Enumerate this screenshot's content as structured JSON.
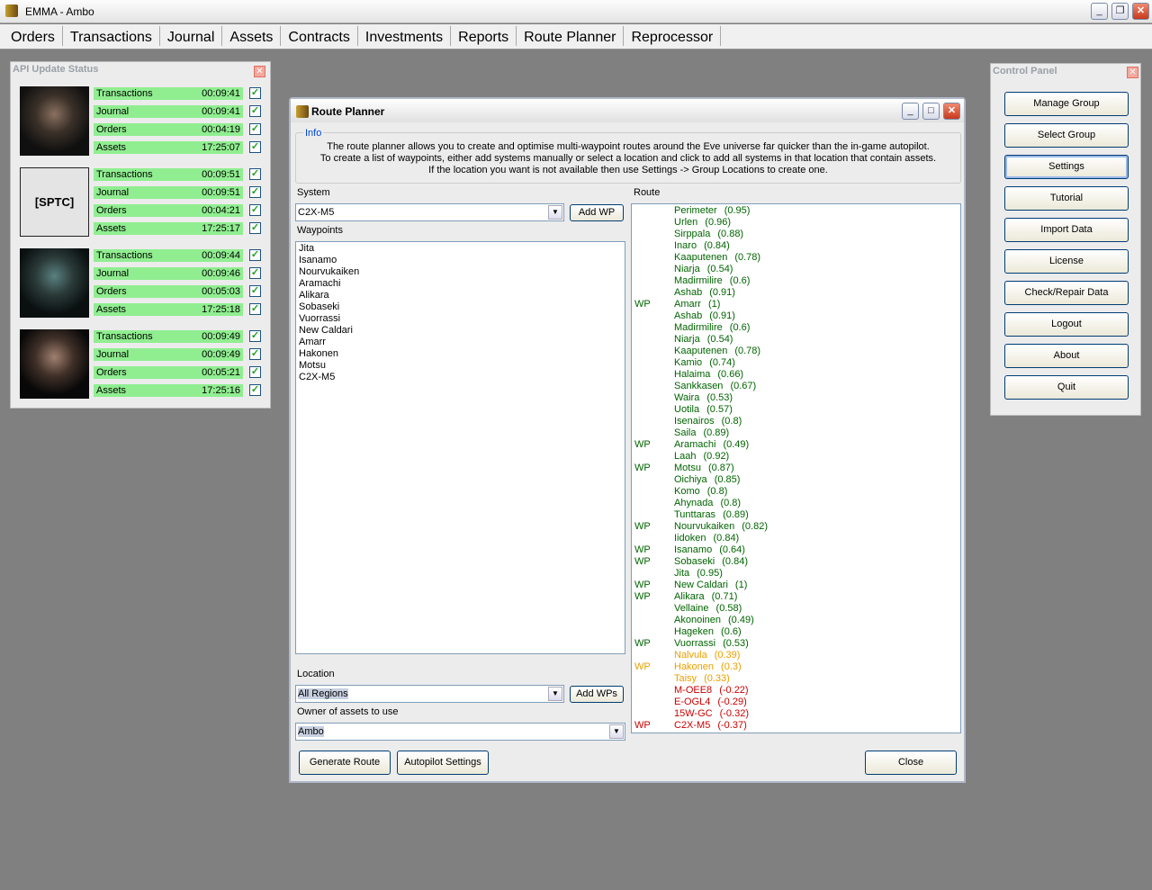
{
  "app": {
    "title": "EMMA - Ambo"
  },
  "menu": [
    "Orders",
    "Transactions",
    "Journal",
    "Assets",
    "Contracts",
    "Investments",
    "Reports",
    "Route Planner",
    "Reprocessor"
  ],
  "api_panel": {
    "title": "API Update Status",
    "characters": [
      {
        "kind": "portrait",
        "rows": [
          [
            "Transactions",
            "00:09:41"
          ],
          [
            "Journal",
            "00:09:41"
          ],
          [
            "Orders",
            "00:04:19"
          ],
          [
            "Assets",
            "17:25:07"
          ]
        ]
      },
      {
        "kind": "corp",
        "label": "[SPTC]",
        "rows": [
          [
            "Transactions",
            "00:09:51"
          ],
          [
            "Journal",
            "00:09:51"
          ],
          [
            "Orders",
            "00:04:21"
          ],
          [
            "Assets",
            "17:25:17"
          ]
        ]
      },
      {
        "kind": "portrait",
        "rows": [
          [
            "Transactions",
            "00:09:44"
          ],
          [
            "Journal",
            "00:09:46"
          ],
          [
            "Orders",
            "00:05:03"
          ],
          [
            "Assets",
            "17:25:18"
          ]
        ]
      },
      {
        "kind": "portrait",
        "rows": [
          [
            "Transactions",
            "00:09:49"
          ],
          [
            "Journal",
            "00:09:49"
          ],
          [
            "Orders",
            "00:05:21"
          ],
          [
            "Assets",
            "17:25:16"
          ]
        ]
      }
    ]
  },
  "control_panel": {
    "title": "Control Panel",
    "buttons": [
      "Manage Group",
      "Select Group",
      "Settings",
      "Tutorial",
      "Import Data",
      "License",
      "Check/Repair Data",
      "Logout",
      "About",
      "Quit"
    ]
  },
  "route_planner": {
    "title": "Route Planner",
    "info_label": "Info",
    "info_lines": [
      "The route planner allows you to create and optimise multi-waypoint routes around the Eve universe far quicker than the in-game autopilot.",
      "To create a list of waypoints, either add systems manually or select a location and click to add all systems in that location that contain assets.",
      "If the location you want is not available then use Settings -> Group Locations to create one."
    ],
    "system_label": "System",
    "system_value": "C2X-M5",
    "add_wp": "Add WP",
    "waypoints_label": "Waypoints",
    "waypoints": [
      "Jita",
      "Isanamo",
      "Nourvukaiken",
      "Aramachi",
      "Alikara",
      "Sobaseki",
      "Vuorrassi",
      "New Caldari",
      "Amarr",
      "Hakonen",
      "Motsu",
      "C2X-M5"
    ],
    "location_label": "Location",
    "location_value": "All Regions",
    "add_wps": "Add WPs",
    "owner_label": "Owner of assets to use",
    "owner_value": "Ambo",
    "route_label": "Route",
    "generate": "Generate Route",
    "autopilot": "Autopilot Settings",
    "close": "Close",
    "colors": {
      "high": "#006400",
      "low": "#e8a000",
      "null": "#cc0000"
    },
    "route": [
      [
        "",
        "Perimeter",
        "(0.95)"
      ],
      [
        "",
        "Urlen",
        "(0.96)"
      ],
      [
        "",
        "Sirppala",
        "(0.88)"
      ],
      [
        "",
        "Inaro",
        "(0.84)"
      ],
      [
        "",
        "Kaaputenen",
        "(0.78)"
      ],
      [
        "",
        "Niarja",
        "(0.54)"
      ],
      [
        "",
        "Madirmilire",
        "(0.6)"
      ],
      [
        "",
        "Ashab",
        "(0.91)"
      ],
      [
        "WP",
        "Amarr",
        "(1)"
      ],
      [
        "",
        "Ashab",
        "(0.91)"
      ],
      [
        "",
        "Madirmilire",
        "(0.6)"
      ],
      [
        "",
        "Niarja",
        "(0.54)"
      ],
      [
        "",
        "Kaaputenen",
        "(0.78)"
      ],
      [
        "",
        "Kamio",
        "(0.74)"
      ],
      [
        "",
        "Halaima",
        "(0.66)"
      ],
      [
        "",
        "Sankkasen",
        "(0.67)"
      ],
      [
        "",
        "Waira",
        "(0.53)"
      ],
      [
        "",
        "Uotila",
        "(0.57)"
      ],
      [
        "",
        "Isenairos",
        "(0.8)"
      ],
      [
        "",
        "Saila",
        "(0.89)"
      ],
      [
        "WP",
        "Aramachi",
        "(0.49)"
      ],
      [
        "",
        "Laah",
        "(0.92)"
      ],
      [
        "WP",
        "Motsu",
        "(0.87)"
      ],
      [
        "",
        "Oichiya",
        "(0.85)"
      ],
      [
        "",
        "Komo",
        "(0.8)"
      ],
      [
        "",
        "Ahynada",
        "(0.8)"
      ],
      [
        "",
        "Tunttaras",
        "(0.89)"
      ],
      [
        "WP",
        "Nourvukaiken",
        "(0.82)"
      ],
      [
        "",
        "Iidoken",
        "(0.84)"
      ],
      [
        "WP",
        "Isanamo",
        "(0.64)"
      ],
      [
        "WP",
        "Sobaseki",
        "(0.84)"
      ],
      [
        "",
        "Jita",
        "(0.95)"
      ],
      [
        "WP",
        "New Caldari",
        "(1)"
      ],
      [
        "WP",
        "Alikara",
        "(0.71)"
      ],
      [
        "",
        "Vellaine",
        "(0.58)"
      ],
      [
        "",
        "Akonoinen",
        "(0.49)"
      ],
      [
        "",
        "Hageken",
        "(0.6)"
      ],
      [
        "WP",
        "Vuorrassi",
        "(0.53)"
      ],
      [
        "",
        "Nalvula",
        "(0.39)"
      ],
      [
        "WP",
        "Hakonen",
        "(0.3)"
      ],
      [
        "",
        "Taisy",
        "(0.33)"
      ],
      [
        "",
        "M-OEE8",
        "(-0.22)"
      ],
      [
        "",
        "E-OGL4",
        "(-0.29)"
      ],
      [
        "",
        "15W-GC",
        "(-0.32)"
      ],
      [
        "WP",
        "C2X-M5",
        "(-0.37)"
      ]
    ]
  }
}
